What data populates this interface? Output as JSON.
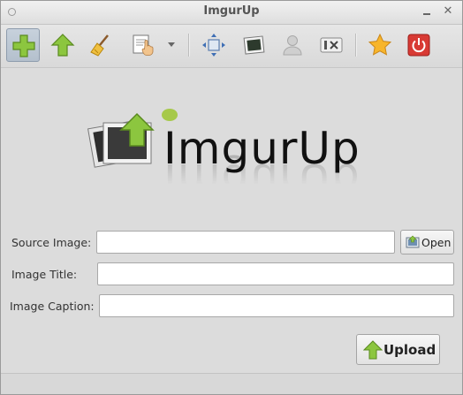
{
  "window": {
    "title": "ImgurUp"
  },
  "toolbar": {
    "items": [
      {
        "icon": "add-icon",
        "active": true
      },
      {
        "icon": "upload-arrow-icon"
      },
      {
        "icon": "broom-icon"
      },
      {
        "icon": "paste-icon"
      },
      {
        "icon": "dropdown-arrow-icon"
      },
      {
        "icon": "move-selection-icon"
      },
      {
        "icon": "image-frame-icon"
      },
      {
        "icon": "user-icon"
      },
      {
        "icon": "settings-tools-icon"
      },
      {
        "icon": "favorite-star-icon"
      },
      {
        "icon": "power-icon"
      }
    ]
  },
  "logo": {
    "text": "ImgurUp"
  },
  "form": {
    "source_label": "Source Image:",
    "source_value": "",
    "open_label": "Open",
    "title_label": "Image Title:",
    "title_value": "",
    "caption_label": "Image Caption:",
    "caption_value": "",
    "upload_label": "Upload"
  },
  "colors": {
    "accent_green": "#8bc34a",
    "power_red": "#d32f2f",
    "star_gold": "#f5a623"
  }
}
